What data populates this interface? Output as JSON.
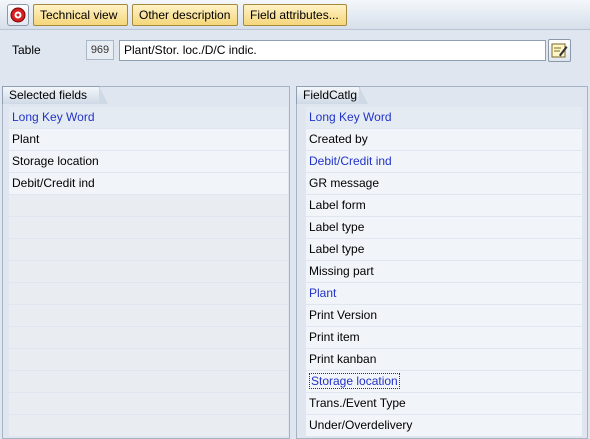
{
  "toolbar": {
    "icon": "red-circle-icon",
    "buttons": [
      "Technical view",
      "Other description",
      "Field attributes..."
    ]
  },
  "table": {
    "label": "Table",
    "number": "969",
    "description": "Plant/Stor. loc./D/C indic."
  },
  "selected_fields": {
    "tab_label": "Selected fields",
    "header": "Long Key Word",
    "rows": [
      "Plant",
      "Storage location",
      "Debit/Credit ind"
    ]
  },
  "field_catalog": {
    "tab_label": "FieldCatlg",
    "header": "Long Key Word",
    "rows": [
      "Created by",
      "Debit/Credit ind",
      "GR message",
      "Label form",
      "Label type",
      "Label type",
      "Missing part",
      "Plant",
      "Print Version",
      "Print item",
      "Print kanban",
      "Storage location",
      "Trans./Event Type",
      "Under/Overdelivery"
    ]
  },
  "colors": {
    "accent_blue": "#2233c8",
    "button_yellow": "#f5d67a"
  }
}
